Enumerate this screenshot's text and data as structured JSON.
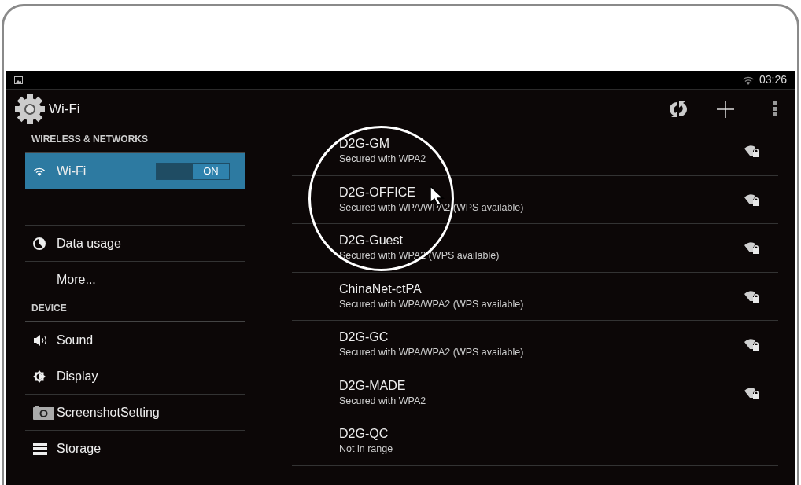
{
  "status_bar": {
    "time": "03:26"
  },
  "action_bar": {
    "title": "Wi-Fi"
  },
  "sidebar": {
    "sections": [
      {
        "header": "WIRELESS & NETWORKS",
        "items": [
          {
            "label": "Wi-Fi",
            "selected": true,
            "kind": "toggle",
            "toggle": {
              "on": true,
              "label": "ON"
            }
          },
          {
            "kind": "blank"
          },
          {
            "label": "Data usage",
            "selected": false,
            "kind": "item"
          },
          {
            "label": "More...",
            "selected": false,
            "kind": "item"
          }
        ]
      },
      {
        "header": "DEVICE",
        "items": [
          {
            "label": "Sound",
            "selected": false,
            "kind": "item"
          },
          {
            "label": "Display",
            "selected": false,
            "kind": "item"
          },
          {
            "label": "ScreenshotSetting",
            "selected": false,
            "kind": "item"
          },
          {
            "label": "Storage",
            "selected": false,
            "kind": "item"
          }
        ]
      }
    ]
  },
  "networks": [
    {
      "name": "D2G-GM",
      "status": "Secured with WPA2",
      "in_range": true
    },
    {
      "name": "D2G-OFFICE",
      "status": "Secured with WPA/WPA2 (WPS available)",
      "in_range": true
    },
    {
      "name": "D2G-Guest",
      "status": "Secured with WPA2 (WPS available)",
      "in_range": true
    },
    {
      "name": "ChinaNet-ctPA",
      "status": "Secured with WPA/WPA2 (WPS available)",
      "in_range": true
    },
    {
      "name": "D2G-GC",
      "status": "Secured with WPA/WPA2 (WPS available)",
      "in_range": true
    },
    {
      "name": "D2G-MADE",
      "status": "Secured with WPA2",
      "in_range": true
    },
    {
      "name": "D2G-QC",
      "status": "Not in range",
      "in_range": false
    }
  ]
}
